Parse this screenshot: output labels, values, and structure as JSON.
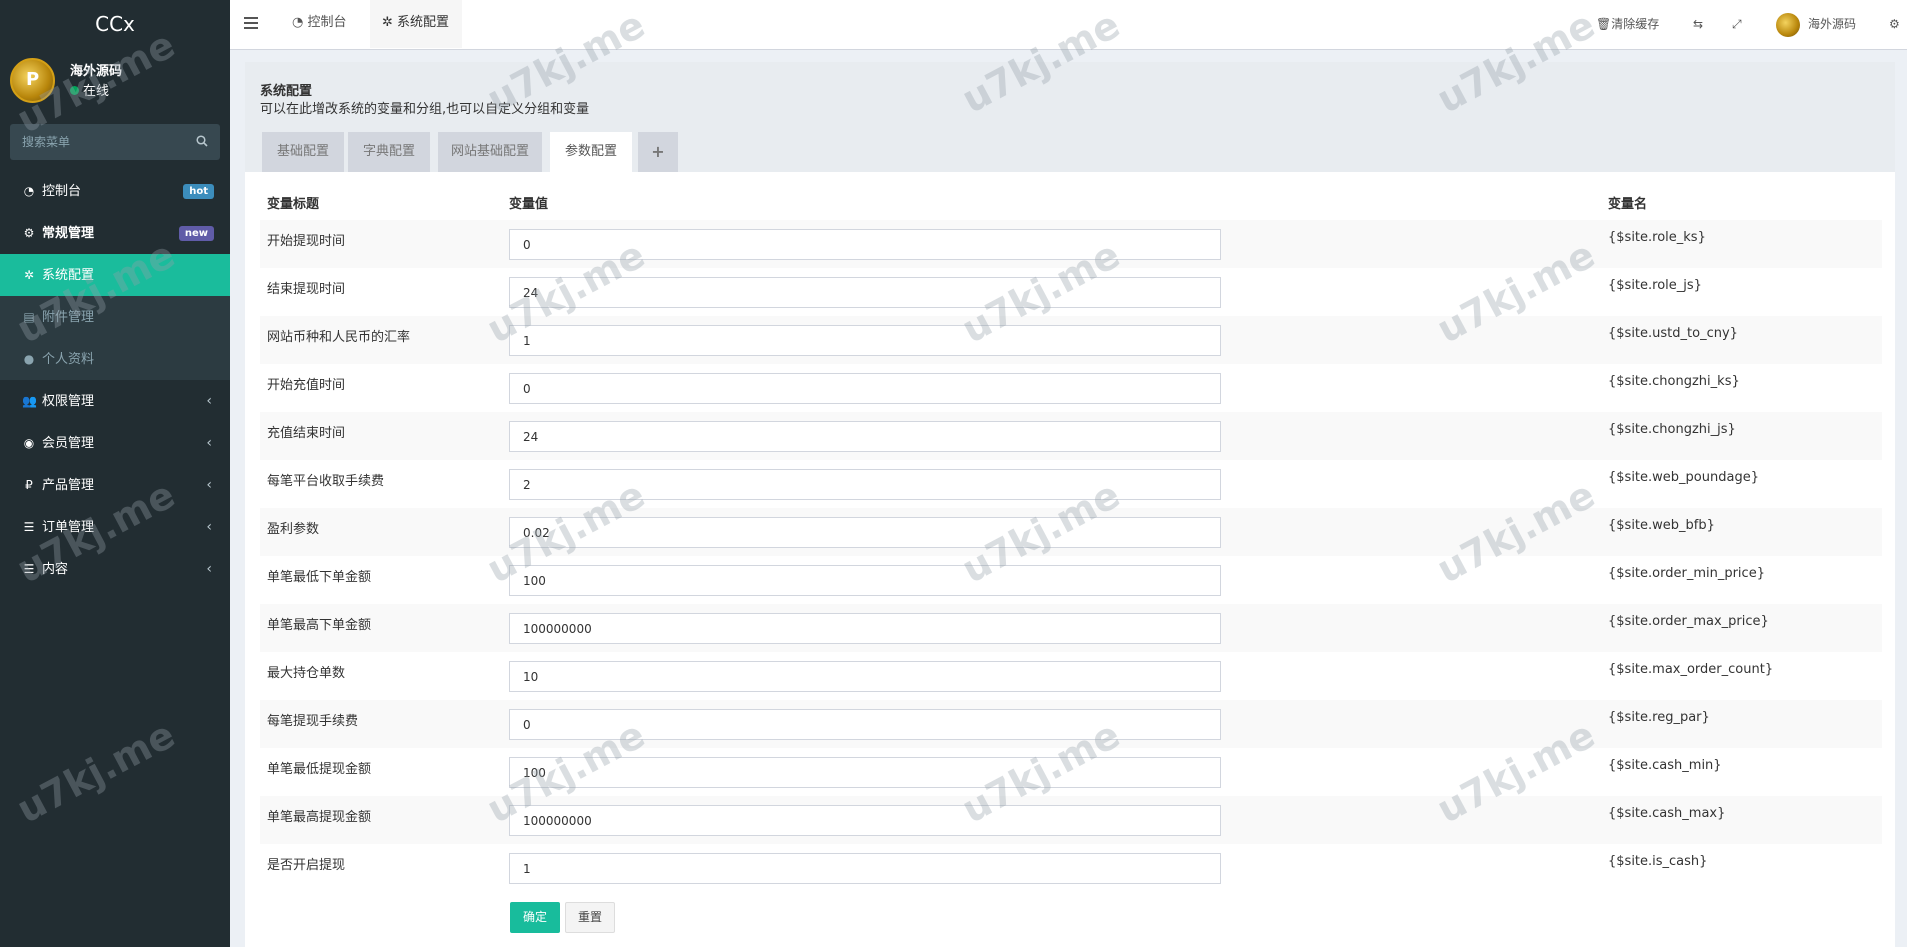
{
  "sidebar": {
    "logo": "CCx",
    "user_name": "海外源码",
    "user_status": "在线",
    "search_placeholder": "搜索菜单",
    "menu": [
      {
        "label": "控制台",
        "icon": "dashboard-icon",
        "badge": "hot"
      },
      {
        "label": "常规管理",
        "icon": "cogs-icon",
        "badge": "new"
      },
      {
        "label": "系统配置",
        "icon": "gear-icon"
      },
      {
        "label": "附件管理",
        "icon": "file-image-icon"
      },
      {
        "label": "个人资料",
        "icon": "user-icon"
      },
      {
        "label": "权限管理",
        "icon": "group-icon"
      },
      {
        "label": "会员管理",
        "icon": "user-circle-icon"
      },
      {
        "label": "产品管理",
        "icon": "ruble-icon"
      },
      {
        "label": "订单管理",
        "icon": "list-icon"
      },
      {
        "label": "内容",
        "icon": "list-icon"
      }
    ]
  },
  "topbar": {
    "tabs": [
      {
        "label": "控制台",
        "icon": "dashboard-icon"
      },
      {
        "label": "系统配置",
        "icon": "gear-icon"
      }
    ],
    "clear_cache": "清除缓存",
    "user_name": "海外源码"
  },
  "config": {
    "title": "系统配置",
    "description": "可以在此增改系统的变量和分组,也可以自定义分组和变量",
    "tabs": [
      "基础配置",
      "字典配置",
      "网站基础配置",
      "参数配置",
      "+"
    ],
    "columns": [
      "变量标题",
      "变量值",
      "变量名"
    ],
    "rows": [
      {
        "title": "开始提现时间",
        "value": "0",
        "name": "{$site.role_ks}"
      },
      {
        "title": "结束提现时间",
        "value": "24",
        "name": "{$site.role_js}"
      },
      {
        "title": "网站币种和人民币的汇率",
        "value": "1",
        "name": "{$site.ustd_to_cny}"
      },
      {
        "title": "开始充值时间",
        "value": "0",
        "name": "{$site.chongzhi_ks}"
      },
      {
        "title": "充值结束时间",
        "value": "24",
        "name": "{$site.chongzhi_js}"
      },
      {
        "title": "每笔平台收取手续费",
        "value": "2",
        "name": "{$site.web_poundage}"
      },
      {
        "title": "盈利参数",
        "value": "0.02",
        "name": "{$site.web_bfb}"
      },
      {
        "title": "单笔最低下单金额",
        "value": "100",
        "name": "{$site.order_min_price}"
      },
      {
        "title": "单笔最高下单金额",
        "value": "100000000",
        "name": "{$site.order_max_price}"
      },
      {
        "title": "最大持仓单数",
        "value": "10",
        "name": "{$site.max_order_count}"
      },
      {
        "title": "每笔提现手续费",
        "value": "0",
        "name": "{$site.reg_par}"
      },
      {
        "title": "单笔最低提现金额",
        "value": "100",
        "name": "{$site.cash_min}"
      },
      {
        "title": "单笔最高提现金额",
        "value": "100000000",
        "name": "{$site.cash_max}"
      },
      {
        "title": "是否开启提现",
        "value": "1",
        "name": "{$site.is_cash}"
      }
    ],
    "submit_label": "确定",
    "reset_label": "重置"
  },
  "watermark": "u7kj.me",
  "colors": {
    "sidebar_bg": "#222d32",
    "accent": "#1abc9c",
    "hot": "#3c8dbc",
    "new": "#605ca8"
  }
}
